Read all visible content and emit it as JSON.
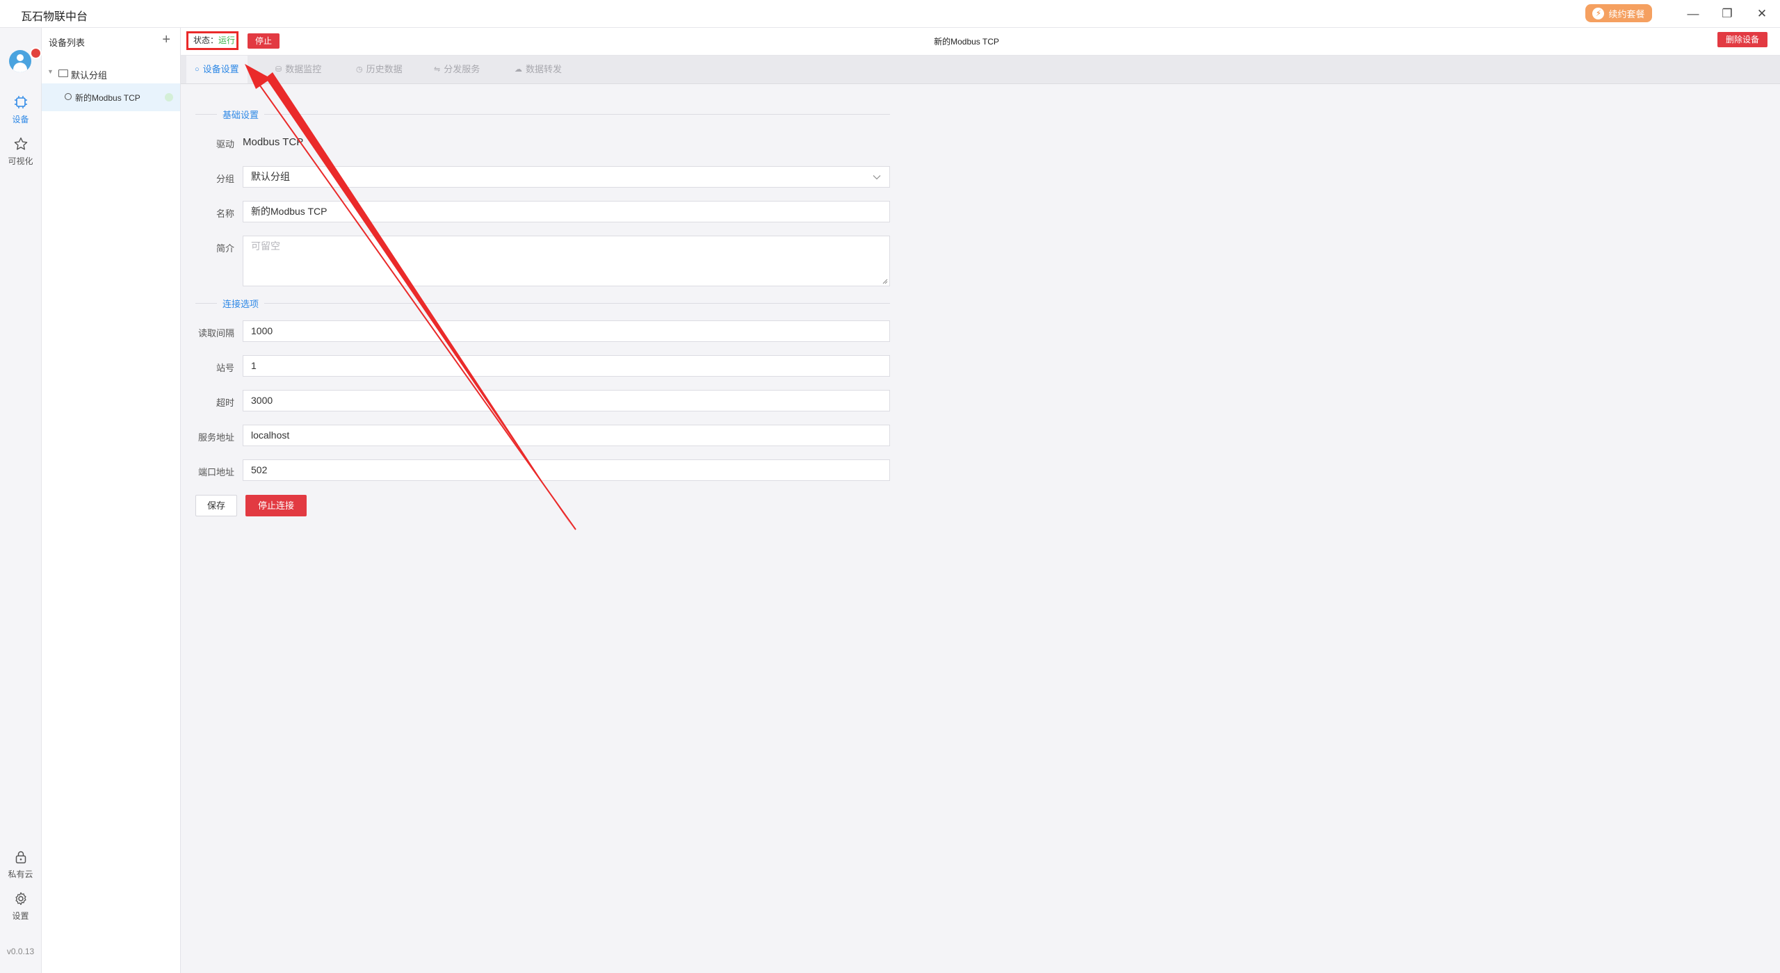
{
  "app": {
    "title": "瓦石物联中台",
    "renew_label": "续约套餐",
    "version": "v0.0.13"
  },
  "window_controls": {
    "minimize": "—",
    "restore": "❐",
    "close": "✕"
  },
  "rail": {
    "items": [
      {
        "label": "设备",
        "icon": "chip-icon",
        "active": true
      },
      {
        "label": "可视化",
        "icon": "star-icon",
        "active": false
      },
      {
        "label": "私有云",
        "icon": "lock-icon",
        "active": false
      },
      {
        "label": "设置",
        "icon": "gear-icon",
        "active": false
      }
    ]
  },
  "device_list": {
    "header": "设备列表",
    "add_icon": "+",
    "group": "默认分组",
    "device": "新的Modbus TCP"
  },
  "status": {
    "label": "状态：",
    "value": "运行",
    "stop_label": "停止"
  },
  "device_title": "新的Modbus TCP",
  "delete_label": "删除设备",
  "tabs": [
    {
      "label": "设备设置",
      "active": true
    },
    {
      "label": "数据监控",
      "active": false
    },
    {
      "label": "历史数据",
      "active": false
    },
    {
      "label": "分发服务",
      "active": false
    },
    {
      "label": "数据转发",
      "active": false
    }
  ],
  "form": {
    "basic_section": "基础设置",
    "driver_label": "驱动",
    "driver_value": "Modbus TCP",
    "group_label": "分组",
    "group_value": "默认分组",
    "name_label": "名称",
    "name_value": "新的Modbus TCP",
    "desc_label": "简介",
    "desc_placeholder": "可留空",
    "conn_section": "连接选项",
    "interval_label": "读取间隔",
    "interval_value": "1000",
    "station_label": "站号",
    "station_value": "1",
    "timeout_label": "超时",
    "timeout_value": "3000",
    "server_label": "服务地址",
    "server_value": "localhost",
    "port_label": "端口地址",
    "port_value": "502",
    "save_label": "保存",
    "disconnect_label": "停止连接"
  },
  "colors": {
    "accent": "#2f89e6",
    "danger": "#e23a42",
    "running": "#3bb54a",
    "annotation": "#ea2a2a"
  }
}
